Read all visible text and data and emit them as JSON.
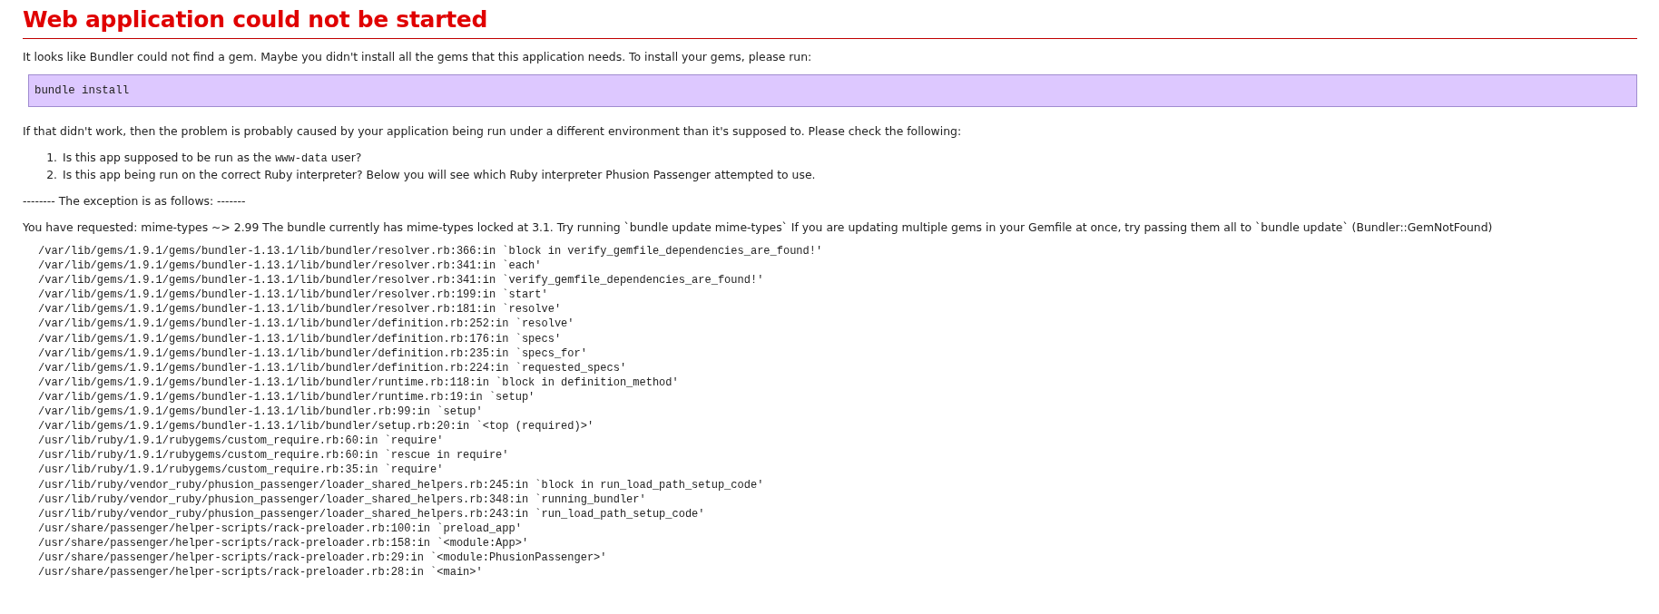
{
  "title": "Web application could not be started",
  "intro": "It looks like Bundler could not find a gem. Maybe you didn't install all the gems that this application needs. To install your gems, please run:",
  "command": "bundle install",
  "hint": "If that didn't work, then the problem is probably caused by your application being run under a different environment than it's supposed to. Please check the following:",
  "checks": [
    {
      "number": "1.",
      "before": "Is this app supposed to be run as the ",
      "code": "www-data",
      "after": " user?"
    },
    {
      "number": "2.",
      "before": "Is this app being run on the correct Ruby interpreter? Below you will see which Ruby interpreter Phusion Passenger attempted to use."
    }
  ],
  "separator": "-------- The exception is as follows: -------",
  "exception": "You have requested: mime-types ~> 2.99 The bundle currently has mime-types locked at 3.1. Try running `bundle update mime-types` If you are updating multiple gems in your Gemfile at once, try passing them all to `bundle update` (Bundler::GemNotFound)",
  "backtrace": [
    "/var/lib/gems/1.9.1/gems/bundler-1.13.1/lib/bundler/resolver.rb:366:in `block in verify_gemfile_dependencies_are_found!'",
    "/var/lib/gems/1.9.1/gems/bundler-1.13.1/lib/bundler/resolver.rb:341:in `each'",
    "/var/lib/gems/1.9.1/gems/bundler-1.13.1/lib/bundler/resolver.rb:341:in `verify_gemfile_dependencies_are_found!'",
    "/var/lib/gems/1.9.1/gems/bundler-1.13.1/lib/bundler/resolver.rb:199:in `start'",
    "/var/lib/gems/1.9.1/gems/bundler-1.13.1/lib/bundler/resolver.rb:181:in `resolve'",
    "/var/lib/gems/1.9.1/gems/bundler-1.13.1/lib/bundler/definition.rb:252:in `resolve'",
    "/var/lib/gems/1.9.1/gems/bundler-1.13.1/lib/bundler/definition.rb:176:in `specs'",
    "/var/lib/gems/1.9.1/gems/bundler-1.13.1/lib/bundler/definition.rb:235:in `specs_for'",
    "/var/lib/gems/1.9.1/gems/bundler-1.13.1/lib/bundler/definition.rb:224:in `requested_specs'",
    "/var/lib/gems/1.9.1/gems/bundler-1.13.1/lib/bundler/runtime.rb:118:in `block in definition_method'",
    "/var/lib/gems/1.9.1/gems/bundler-1.13.1/lib/bundler/runtime.rb:19:in `setup'",
    "/var/lib/gems/1.9.1/gems/bundler-1.13.1/lib/bundler.rb:99:in `setup'",
    "/var/lib/gems/1.9.1/gems/bundler-1.13.1/lib/bundler/setup.rb:20:in `<top (required)>'",
    "/usr/lib/ruby/1.9.1/rubygems/custom_require.rb:60:in `require'",
    "/usr/lib/ruby/1.9.1/rubygems/custom_require.rb:60:in `rescue in require'",
    "/usr/lib/ruby/1.9.1/rubygems/custom_require.rb:35:in `require'",
    "/usr/lib/ruby/vendor_ruby/phusion_passenger/loader_shared_helpers.rb:245:in `block in run_load_path_setup_code'",
    "/usr/lib/ruby/vendor_ruby/phusion_passenger/loader_shared_helpers.rb:348:in `running_bundler'",
    "/usr/lib/ruby/vendor_ruby/phusion_passenger/loader_shared_helpers.rb:243:in `run_load_path_setup_code'",
    "/usr/share/passenger/helper-scripts/rack-preloader.rb:100:in `preload_app'",
    "/usr/share/passenger/helper-scripts/rack-preloader.rb:158:in `<module:App>'",
    "/usr/share/passenger/helper-scripts/rack-preloader.rb:29:in `<module:PhusionPassenger>'",
    "/usr/share/passenger/helper-scripts/rack-preloader.rb:28:in `<main>'"
  ]
}
